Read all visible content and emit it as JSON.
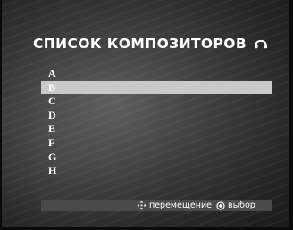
{
  "menu": {
    "title": "СПИСОК КОМПОЗИТОРОВ",
    "icon": "headphones-icon",
    "selected_index": 1,
    "items": [
      "A",
      "B",
      "C",
      "D",
      "E",
      "F",
      "G",
      "H"
    ]
  },
  "footer": {
    "move_label": "перемещение",
    "move_icon": "dpad-icon",
    "select_label": "выбор",
    "select_icon": "enter-icon"
  },
  "colors": {
    "highlight": "#c9c9c9",
    "footer_bar": "#4a4a4a",
    "text": "#ffffff"
  }
}
